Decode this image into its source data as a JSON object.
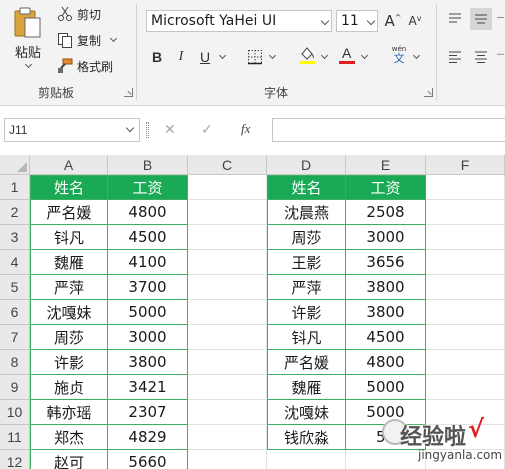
{
  "ribbon": {
    "clipboard": {
      "paste_label": "粘贴",
      "cut_label": "剪切",
      "copy_label": "复制",
      "format_painter_label": "格式刷",
      "group_label": "剪贴板"
    },
    "font": {
      "font_name": "Microsoft YaHei UI",
      "font_size": "11",
      "grow_label": "A",
      "shrink_label": "A",
      "bold_label": "B",
      "italic_label": "I",
      "underline_label": "U",
      "font_color_label": "A",
      "phonetic_top": "wén",
      "phonetic_bottom": "文",
      "group_label": "字体",
      "fill_color": "#ffff00",
      "font_color": "#e02020"
    }
  },
  "formula_bar": {
    "name_box": "J11",
    "cancel_label": "✕",
    "enter_label": "✓",
    "function_label": "fx",
    "formula_value": ""
  },
  "grid": {
    "columns": [
      "A",
      "B",
      "C",
      "D",
      "E",
      "F"
    ],
    "rows": [
      "1",
      "2",
      "3",
      "4",
      "5",
      "6",
      "7",
      "8",
      "9",
      "10",
      "11",
      "12"
    ],
    "left_table": {
      "headers": [
        "姓名",
        "工资"
      ],
      "rows": [
        [
          "严名媛",
          "4800"
        ],
        [
          "钭凡",
          "4500"
        ],
        [
          "魏雁",
          "4100"
        ],
        [
          "严萍",
          "3700"
        ],
        [
          "沈嘎妹",
          "5000"
        ],
        [
          "周莎",
          "3000"
        ],
        [
          "许影",
          "3800"
        ],
        [
          "施贞",
          "3421"
        ],
        [
          "韩亦瑶",
          "2307"
        ],
        [
          "郑杰",
          "4829"
        ],
        [
          "赵可",
          "5660"
        ]
      ]
    },
    "right_table": {
      "headers": [
        "姓名",
        "工资"
      ],
      "rows": [
        [
          "沈晨燕",
          "2508"
        ],
        [
          "周莎",
          "3000"
        ],
        [
          "王影",
          "3656"
        ],
        [
          "严萍",
          "3800"
        ],
        [
          "许影",
          "3800"
        ],
        [
          "钭凡",
          "4500"
        ],
        [
          "严名媛",
          "4800"
        ],
        [
          "魏雁",
          "5000"
        ],
        [
          "沈嘎妹",
          "5000"
        ],
        [
          "钱欣淼",
          "52"
        ]
      ]
    }
  },
  "watermark": {
    "text": "经验啦",
    "url": "jingyanla.com",
    "check": "√"
  },
  "colors": {
    "header_green": "#1aaa55",
    "border_green": "#3fae5e",
    "ribbon_bg": "#f3f3f3"
  }
}
